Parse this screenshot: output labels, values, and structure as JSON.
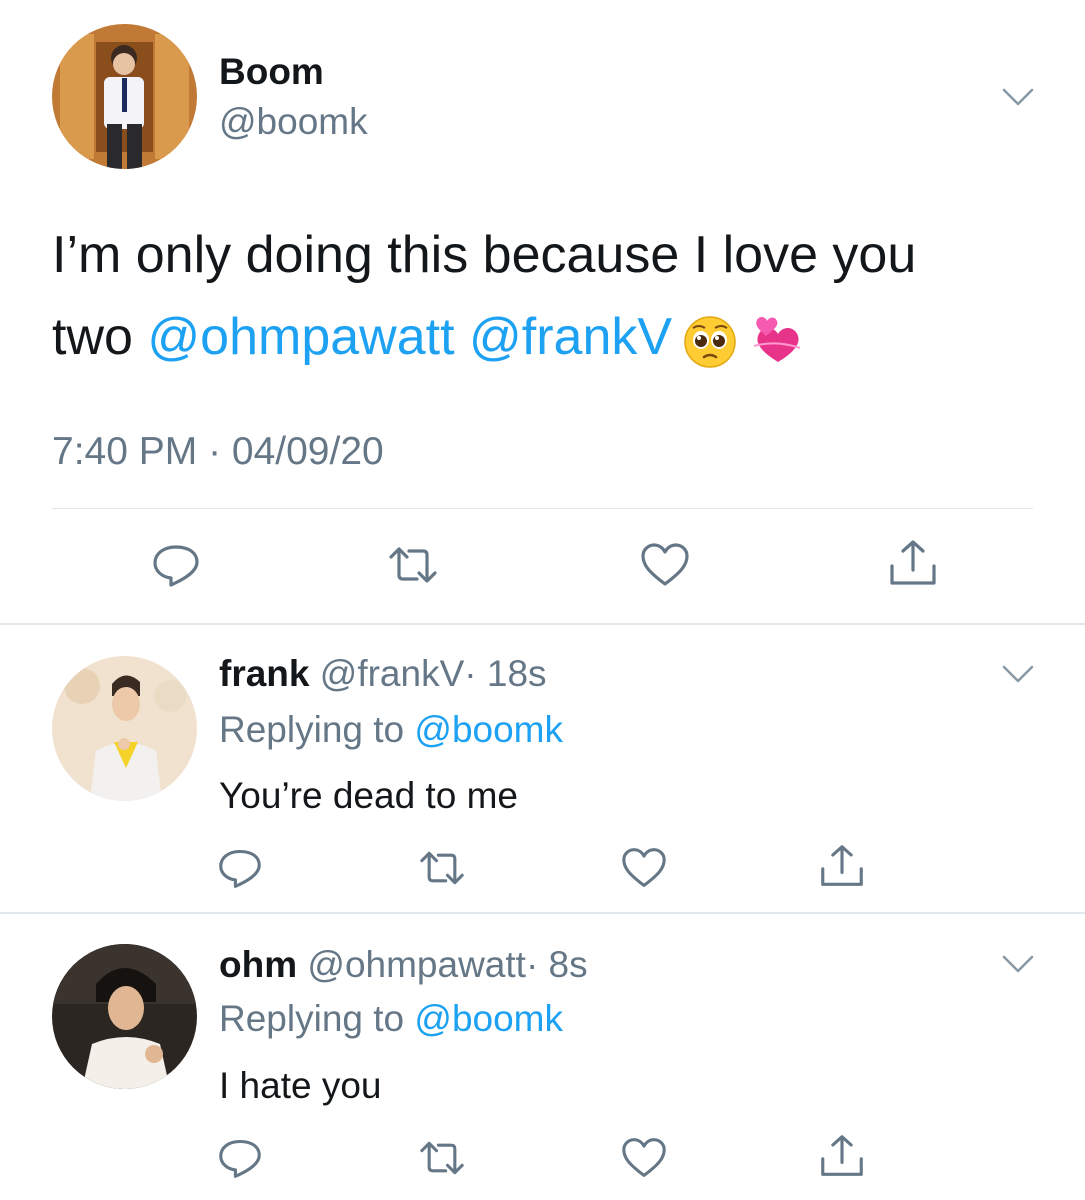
{
  "main_tweet": {
    "author_name": "Boom",
    "author_handle": "@boomk",
    "text_line1": "I’m only doing this because I love you",
    "text_prefix": "two ",
    "mention1": "@ohmpawatt",
    "mention2": "@frankV",
    "emojis": [
      "pleading-face-emoji",
      "revolving-hearts-emoji"
    ],
    "timestamp": "7:40 PM · 04/09/20"
  },
  "replies": [
    {
      "name": "frank",
      "handle": "@frankV",
      "age": "· 18s",
      "replying_prefix": "Replying to ",
      "replying_to": "@boomk",
      "text": "You’re dead to me"
    },
    {
      "name": "ohm",
      "handle": "@ohmpawatt",
      "age": "· 8s",
      "replying_prefix": "Replying to ",
      "replying_to": "@boomk",
      "text": "I hate you"
    }
  ],
  "icons": [
    "chevron-down-icon",
    "reply-icon",
    "retweet-icon",
    "like-icon",
    "share-icon"
  ],
  "colors": {
    "link": "#1da1f2",
    "secondary_text": "#657786",
    "primary_text": "#14171a",
    "divider": "#e1e8ed"
  }
}
